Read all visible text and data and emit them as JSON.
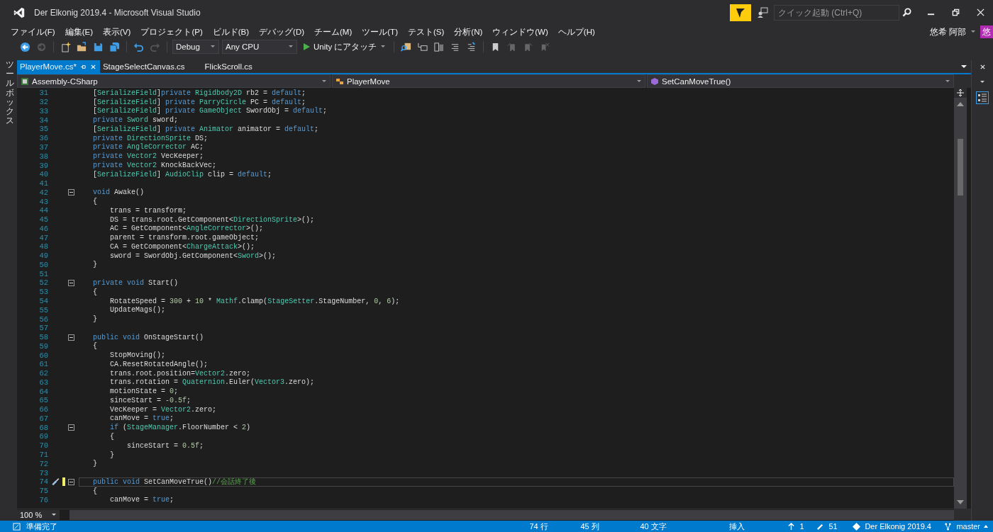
{
  "window": {
    "title": "Der Elkonig 2019.4 - Microsoft Visual Studio",
    "quick_launch_placeholder": "クイック起動 (Ctrl+Q)"
  },
  "menu": [
    "ファイル(F)",
    "編集(E)",
    "表示(V)",
    "プロジェクト(P)",
    "ビルド(B)",
    "デバッグ(D)",
    "チーム(M)",
    "ツール(T)",
    "テスト(S)",
    "分析(N)",
    "ウィンドウ(W)",
    "ヘルプ(H)"
  ],
  "account": {
    "name": "悠希 阿部",
    "initial": "悠"
  },
  "toolbar": {
    "configuration": "Debug",
    "platform": "Any CPU",
    "attach": "Unity にアタッチ"
  },
  "toolbox": {
    "label": "ツールボックス"
  },
  "tabs": [
    {
      "label": "PlayerMove.cs*",
      "selected": true
    },
    {
      "label": "StageSelectCanvas.cs",
      "selected": false
    },
    {
      "label": "FlickScroll.cs",
      "selected": false
    }
  ],
  "navigation": {
    "project": "Assembly-CSharp",
    "type": "PlayerMove",
    "member": "SetCanMoveTrue()"
  },
  "editor": {
    "zoom": "100 %",
    "lines": [
      {
        "number": "31",
        "foldable": false,
        "current": false,
        "tokens": [
          {
            "kind": "plain",
            "text": "["
          },
          {
            "kind": "type",
            "text": "SerializeField"
          },
          {
            "kind": "plain",
            "text": "]"
          },
          {
            "kind": "keyword",
            "text": "private "
          },
          {
            "kind": "type",
            "text": "Rigidbody2D"
          },
          {
            "kind": "plain",
            "text": " rb2 = "
          },
          {
            "kind": "keyword",
            "text": "default"
          },
          {
            "kind": "plain",
            "text": ";"
          }
        ]
      },
      {
        "number": "32",
        "foldable": false,
        "current": false,
        "tokens": [
          {
            "kind": "plain",
            "text": "["
          },
          {
            "kind": "type",
            "text": "SerializeField"
          },
          {
            "kind": "plain",
            "text": "] "
          },
          {
            "kind": "keyword",
            "text": "private "
          },
          {
            "kind": "type",
            "text": "ParryCircle"
          },
          {
            "kind": "plain",
            "text": " PC = "
          },
          {
            "kind": "keyword",
            "text": "default"
          },
          {
            "kind": "plain",
            "text": ";"
          }
        ]
      },
      {
        "number": "33",
        "foldable": false,
        "current": false,
        "tokens": [
          {
            "kind": "plain",
            "text": "["
          },
          {
            "kind": "type",
            "text": "SerializeField"
          },
          {
            "kind": "plain",
            "text": "] "
          },
          {
            "kind": "keyword",
            "text": "private "
          },
          {
            "kind": "type",
            "text": "GameObject"
          },
          {
            "kind": "plain",
            "text": " SwordObj = "
          },
          {
            "kind": "keyword",
            "text": "default"
          },
          {
            "kind": "plain",
            "text": ";"
          }
        ]
      },
      {
        "number": "34",
        "foldable": false,
        "current": false,
        "tokens": [
          {
            "kind": "keyword",
            "text": "private "
          },
          {
            "kind": "type",
            "text": "Sword"
          },
          {
            "kind": "plain",
            "text": " sword;"
          }
        ]
      },
      {
        "number": "35",
        "foldable": false,
        "current": false,
        "tokens": [
          {
            "kind": "plain",
            "text": "["
          },
          {
            "kind": "type",
            "text": "SerializeField"
          },
          {
            "kind": "plain",
            "text": "] "
          },
          {
            "kind": "keyword",
            "text": "private "
          },
          {
            "kind": "type",
            "text": "Animator"
          },
          {
            "kind": "plain",
            "text": " animator = "
          },
          {
            "kind": "keyword",
            "text": "default"
          },
          {
            "kind": "plain",
            "text": ";"
          }
        ]
      },
      {
        "number": "36",
        "foldable": false,
        "current": false,
        "tokens": [
          {
            "kind": "keyword",
            "text": "private "
          },
          {
            "kind": "type",
            "text": "DirectionSprite"
          },
          {
            "kind": "plain",
            "text": " DS;"
          }
        ]
      },
      {
        "number": "37",
        "foldable": false,
        "current": false,
        "tokens": [
          {
            "kind": "keyword",
            "text": "private "
          },
          {
            "kind": "type",
            "text": "AngleCorrector"
          },
          {
            "kind": "plain",
            "text": " AC;"
          }
        ]
      },
      {
        "number": "38",
        "foldable": false,
        "current": false,
        "tokens": [
          {
            "kind": "keyword",
            "text": "private "
          },
          {
            "kind": "type",
            "text": "Vector2"
          },
          {
            "kind": "plain",
            "text": " VecKeeper;"
          }
        ]
      },
      {
        "number": "39",
        "foldable": false,
        "current": false,
        "tokens": [
          {
            "kind": "keyword",
            "text": "private "
          },
          {
            "kind": "type",
            "text": "Vector2"
          },
          {
            "kind": "plain",
            "text": " KnockBackVec;"
          }
        ]
      },
      {
        "number": "40",
        "foldable": false,
        "current": false,
        "tokens": [
          {
            "kind": "plain",
            "text": "["
          },
          {
            "kind": "type",
            "text": "SerializeField"
          },
          {
            "kind": "plain",
            "text": "] "
          },
          {
            "kind": "type",
            "text": "AudioClip"
          },
          {
            "kind": "plain",
            "text": " clip = "
          },
          {
            "kind": "keyword",
            "text": "default"
          },
          {
            "kind": "plain",
            "text": ";"
          }
        ]
      },
      {
        "number": "41",
        "foldable": false,
        "current": false
      },
      {
        "number": "42",
        "foldable": true,
        "current": false,
        "tokens": [
          {
            "kind": "keyword",
            "text": "void "
          },
          {
            "kind": "plain",
            "text": "Awake()"
          }
        ]
      },
      {
        "number": "43",
        "foldable": false,
        "current": false,
        "tokens": [
          {
            "kind": "plain",
            "text": "{"
          }
        ]
      },
      {
        "number": "44",
        "foldable": false,
        "current": false,
        "tokens": [
          {
            "kind": "plain",
            "text": "    trans = transform;"
          }
        ]
      },
      {
        "number": "45",
        "foldable": false,
        "current": false,
        "tokens": [
          {
            "kind": "plain",
            "text": "    DS = trans.root.GetComponent<"
          },
          {
            "kind": "type",
            "text": "DirectionSprite"
          },
          {
            "kind": "plain",
            "text": ">();"
          }
        ]
      },
      {
        "number": "46",
        "foldable": false,
        "current": false,
        "tokens": [
          {
            "kind": "plain",
            "text": "    AC = GetComponent<"
          },
          {
            "kind": "type",
            "text": "AngleCorrector"
          },
          {
            "kind": "plain",
            "text": ">();"
          }
        ]
      },
      {
        "number": "47",
        "foldable": false,
        "current": false,
        "tokens": [
          {
            "kind": "plain",
            "text": "    parent = transform.root.gameObject;"
          }
        ]
      },
      {
        "number": "48",
        "foldable": false,
        "current": false,
        "tokens": [
          {
            "kind": "plain",
            "text": "    CA = GetComponent<"
          },
          {
            "kind": "type",
            "text": "ChargeAttack"
          },
          {
            "kind": "plain",
            "text": ">();"
          }
        ]
      },
      {
        "number": "49",
        "foldable": false,
        "current": false,
        "tokens": [
          {
            "kind": "plain",
            "text": "    sword = SwordObj.GetComponent<"
          },
          {
            "kind": "type",
            "text": "Sword"
          },
          {
            "kind": "plain",
            "text": ">();"
          }
        ]
      },
      {
        "number": "50",
        "foldable": false,
        "current": false,
        "tokens": [
          {
            "kind": "plain",
            "text": "}"
          }
        ]
      },
      {
        "number": "51",
        "foldable": false,
        "current": false
      },
      {
        "number": "52",
        "foldable": true,
        "current": false,
        "tokens": [
          {
            "kind": "keyword",
            "text": "private void "
          },
          {
            "kind": "plain",
            "text": "Start()"
          }
        ]
      },
      {
        "number": "53",
        "foldable": false,
        "current": false,
        "tokens": [
          {
            "kind": "plain",
            "text": "{"
          }
        ]
      },
      {
        "number": "54",
        "foldable": false,
        "current": false,
        "tokens": [
          {
            "kind": "plain",
            "text": "    RotateSpeed = "
          },
          {
            "kind": "number",
            "text": "300"
          },
          {
            "kind": "plain",
            "text": " + "
          },
          {
            "kind": "number",
            "text": "10"
          },
          {
            "kind": "plain",
            "text": " * "
          },
          {
            "kind": "type",
            "text": "Mathf"
          },
          {
            "kind": "plain",
            "text": ".Clamp("
          },
          {
            "kind": "type",
            "text": "StageSetter"
          },
          {
            "kind": "plain",
            "text": ".StageNumber, "
          },
          {
            "kind": "number",
            "text": "0"
          },
          {
            "kind": "plain",
            "text": ", "
          },
          {
            "kind": "number",
            "text": "6"
          },
          {
            "kind": "plain",
            "text": ");"
          }
        ]
      },
      {
        "number": "55",
        "foldable": false,
        "current": false,
        "tokens": [
          {
            "kind": "plain",
            "text": "    UpdateMags();"
          }
        ]
      },
      {
        "number": "56",
        "foldable": false,
        "current": false,
        "tokens": [
          {
            "kind": "plain",
            "text": "}"
          }
        ]
      },
      {
        "number": "57",
        "foldable": false,
        "current": false
      },
      {
        "number": "58",
        "foldable": true,
        "current": false,
        "tokens": [
          {
            "kind": "keyword",
            "text": "public void "
          },
          {
            "kind": "plain",
            "text": "OnStageStart()"
          }
        ]
      },
      {
        "number": "59",
        "foldable": false,
        "current": false,
        "tokens": [
          {
            "kind": "plain",
            "text": "{"
          }
        ]
      },
      {
        "number": "60",
        "foldable": false,
        "current": false,
        "tokens": [
          {
            "kind": "plain",
            "text": "    StopMoving();"
          }
        ]
      },
      {
        "number": "61",
        "foldable": false,
        "current": false,
        "tokens": [
          {
            "kind": "plain",
            "text": "    CA.ResetRotatedAngle();"
          }
        ]
      },
      {
        "number": "62",
        "foldable": false,
        "current": false,
        "tokens": [
          {
            "kind": "plain",
            "text": "    trans.root.position="
          },
          {
            "kind": "type",
            "text": "Vector2"
          },
          {
            "kind": "plain",
            "text": ".zero;"
          }
        ]
      },
      {
        "number": "63",
        "foldable": false,
        "current": false,
        "tokens": [
          {
            "kind": "plain",
            "text": "    trans.rotation = "
          },
          {
            "kind": "type",
            "text": "Quaternion"
          },
          {
            "kind": "plain",
            "text": ".Euler("
          },
          {
            "kind": "type",
            "text": "Vector3"
          },
          {
            "kind": "plain",
            "text": ".zero);"
          }
        ]
      },
      {
        "number": "64",
        "foldable": false,
        "current": false,
        "tokens": [
          {
            "kind": "plain",
            "text": "    motionState = "
          },
          {
            "kind": "number",
            "text": "0"
          },
          {
            "kind": "plain",
            "text": ";"
          }
        ]
      },
      {
        "number": "65",
        "foldable": false,
        "current": false,
        "tokens": [
          {
            "kind": "plain",
            "text": "    sinceStart = "
          },
          {
            "kind": "number",
            "text": "-0.5f"
          },
          {
            "kind": "plain",
            "text": ";"
          }
        ]
      },
      {
        "number": "66",
        "foldable": false,
        "current": false,
        "tokens": [
          {
            "kind": "plain",
            "text": "    VecKeeper = "
          },
          {
            "kind": "type",
            "text": "Vector2"
          },
          {
            "kind": "plain",
            "text": ".zero;"
          }
        ]
      },
      {
        "number": "67",
        "foldable": false,
        "current": false,
        "tokens": [
          {
            "kind": "plain",
            "text": "    canMove = "
          },
          {
            "kind": "keyword",
            "text": "true"
          },
          {
            "kind": "plain",
            "text": ";"
          }
        ]
      },
      {
        "number": "68",
        "foldable": true,
        "current": false,
        "tokens": [
          {
            "kind": "keyword",
            "text": "    if"
          },
          {
            "kind": "plain",
            "text": " ("
          },
          {
            "kind": "type",
            "text": "StageManager"
          },
          {
            "kind": "plain",
            "text": ".FloorNumber < "
          },
          {
            "kind": "number",
            "text": "2"
          },
          {
            "kind": "plain",
            "text": ")"
          }
        ]
      },
      {
        "number": "69",
        "foldable": false,
        "current": false,
        "tokens": [
          {
            "kind": "plain",
            "text": "    {"
          }
        ]
      },
      {
        "number": "70",
        "foldable": false,
        "current": false,
        "tokens": [
          {
            "kind": "plain",
            "text": "        sinceStart = "
          },
          {
            "kind": "number",
            "text": "0.5f"
          },
          {
            "kind": "plain",
            "text": ";"
          }
        ]
      },
      {
        "number": "71",
        "foldable": false,
        "current": false,
        "tokens": [
          {
            "kind": "plain",
            "text": "    }"
          }
        ]
      },
      {
        "number": "72",
        "foldable": false,
        "current": false,
        "tokens": [
          {
            "kind": "plain",
            "text": "}"
          }
        ]
      },
      {
        "number": "73",
        "foldable": false,
        "current": false
      },
      {
        "number": "74",
        "foldable": true,
        "current": true,
        "tokens": [
          {
            "kind": "keyword",
            "text": "public void "
          },
          {
            "kind": "plain",
            "text": "SetCanMoveTrue()"
          },
          {
            "kind": "comment",
            "text": "//会話終了後"
          }
        ]
      },
      {
        "number": "75",
        "foldable": false,
        "current": false,
        "tokens": [
          {
            "kind": "plain",
            "text": "{"
          }
        ]
      },
      {
        "number": "76",
        "foldable": false,
        "current": false,
        "tokens": [
          {
            "kind": "plain",
            "text": "    canMove = "
          },
          {
            "kind": "keyword",
            "text": "true"
          },
          {
            "kind": "plain",
            "text": ";"
          }
        ]
      }
    ]
  },
  "status_bar": {
    "message": "準備完了",
    "line": "74 行",
    "column": "45 列",
    "chars": "40 文字",
    "mode": "挿入",
    "pushes": "1",
    "edits": "51",
    "repository": "Der Elkonig 2019.4",
    "branch": "master"
  }
}
